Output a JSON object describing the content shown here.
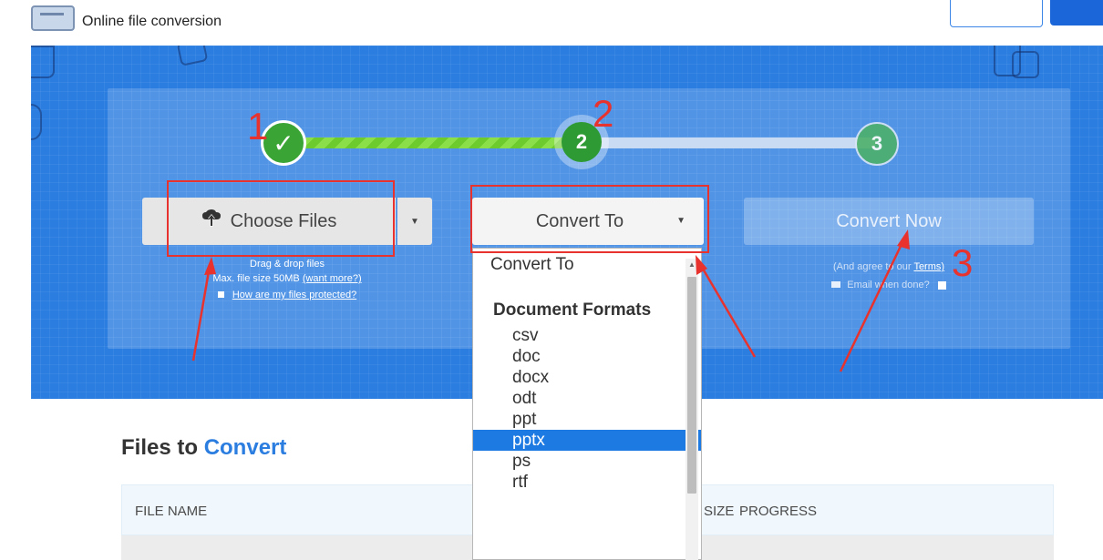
{
  "header": {
    "tagline": "Online file conversion"
  },
  "steps": {
    "step1": "✓",
    "step2": "2",
    "step3": "3"
  },
  "choose": {
    "label": "Choose Files",
    "drag_text": "Drag & drop files",
    "size_text": "Max. file size 50MB",
    "want_more": "(want more?)",
    "protected_link": "How are my files protected?"
  },
  "convert_to": {
    "label": "Convert To"
  },
  "convert_now": {
    "label": "Convert Now",
    "agree_prefix": "(And agree to our",
    "terms": "Terms)",
    "email_text": "Email when done?"
  },
  "files_section": {
    "title_prefix": "Files to",
    "title_accent": "Convert",
    "col_file_name": "FILE NAME",
    "col_size": "SIZE",
    "col_progress": "PROGRESS"
  },
  "dropdown": {
    "first": "Convert To",
    "group": "Document Formats",
    "options": [
      "csv",
      "doc",
      "docx",
      "odt",
      "ppt",
      "pptx",
      "ps",
      "rtf"
    ],
    "selected": "pptx"
  },
  "annotations": {
    "n1": "1",
    "n2": "2",
    "n3": "3"
  },
  "colors": {
    "hero_blue": "#2b7de0",
    "progress_green": "#6ecb2e",
    "selected_blue": "#1e7ae3",
    "annotation_red": "#e8322e"
  }
}
